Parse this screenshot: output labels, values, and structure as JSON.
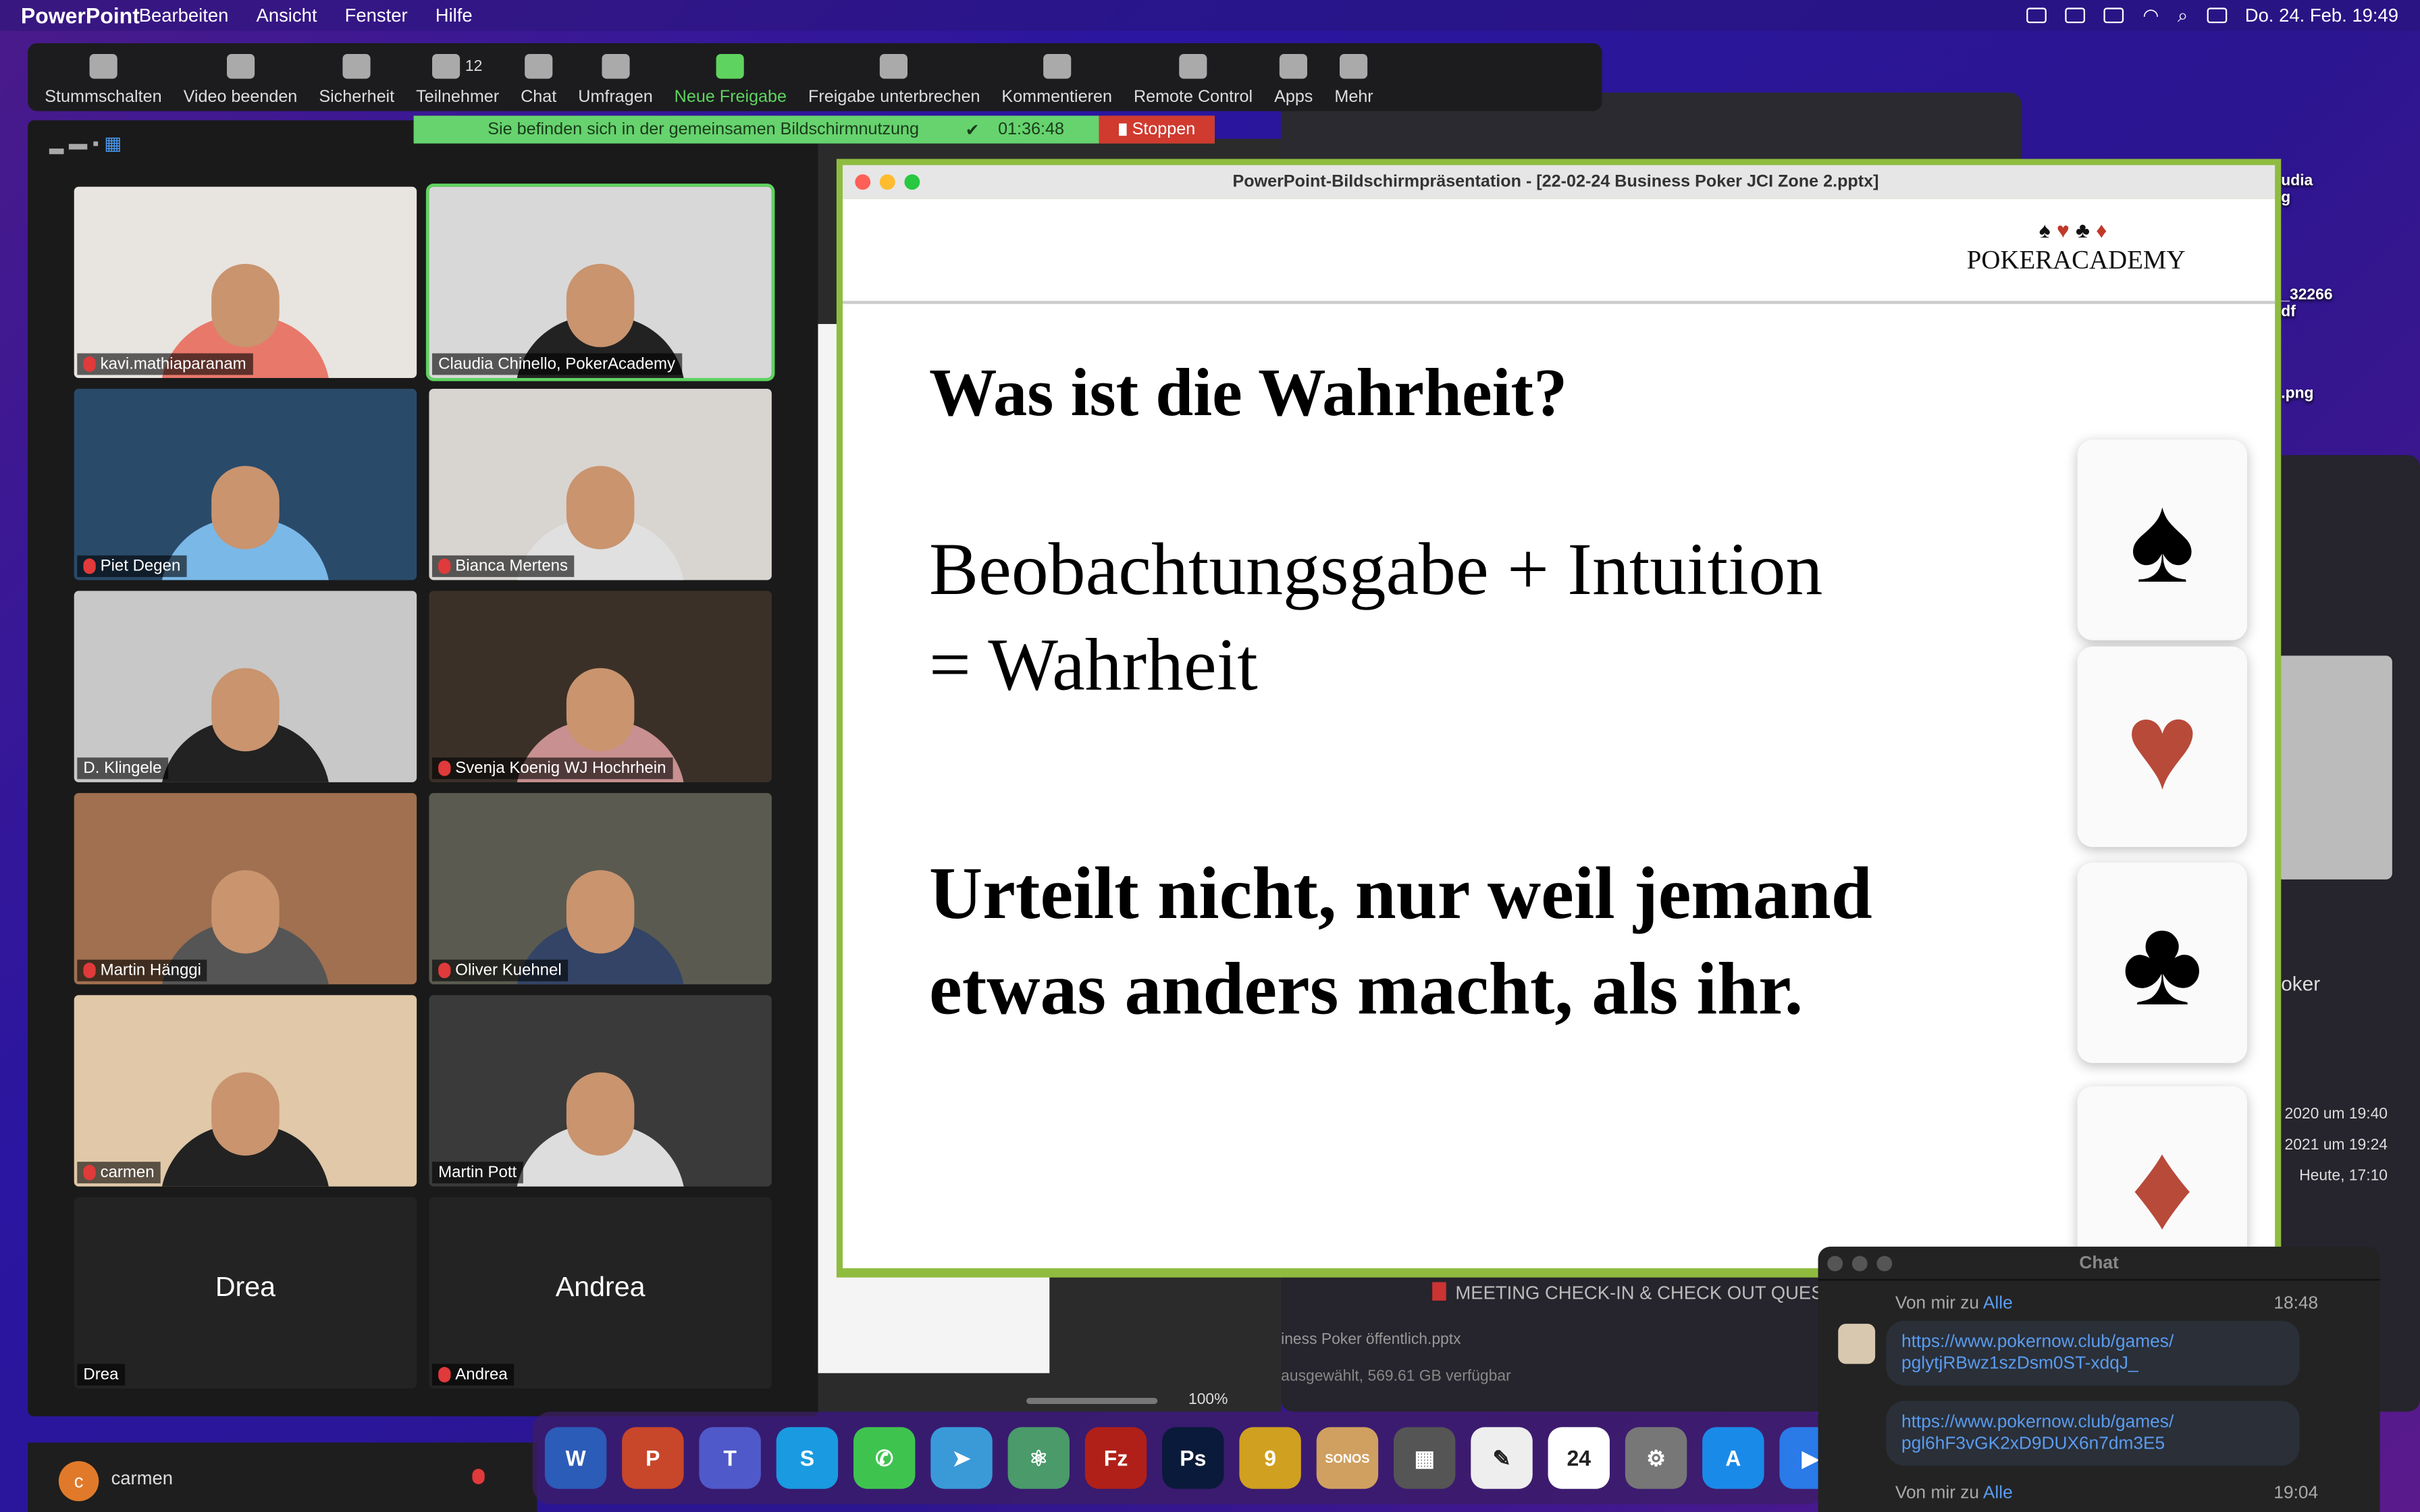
{
  "menubar": {
    "app": "PowerPoint",
    "items": [
      "Bearbeiten",
      "Ansicht",
      "Fenster",
      "Hilfe"
    ],
    "clock": "Do. 24. Feb. 19:49"
  },
  "toolbar": {
    "items": [
      {
        "label": "Stummschalten",
        "icon": "microphone-icon"
      },
      {
        "label": "Video beenden",
        "icon": "video-camera-icon"
      },
      {
        "label": "Sicherheit",
        "icon": "shield-icon"
      },
      {
        "label": "Teilnehmer",
        "icon": "participants-icon",
        "count": "12"
      },
      {
        "label": "Chat",
        "icon": "chat-bubble-icon"
      },
      {
        "label": "Umfragen",
        "icon": "poll-icon"
      },
      {
        "label": "Neue Freigabe",
        "icon": "share-screen-icon"
      },
      {
        "label": "Freigabe unterbrechen",
        "icon": "pause-icon"
      },
      {
        "label": "Kommentieren",
        "icon": "pen-icon"
      },
      {
        "label": "Remote Control",
        "icon": "mouse-icon"
      },
      {
        "label": "Apps",
        "icon": "apps-icon"
      },
      {
        "label": "Mehr",
        "icon": "more-dots-icon"
      }
    ]
  },
  "sharebar": {
    "text": "Sie befinden sich in der gemeinsamen Bildschirmnutzung",
    "timer": "01:36:48",
    "stop": "Stoppen"
  },
  "participants": [
    {
      "name": "kavi.mathiaparanam",
      "muted": true,
      "bg": "#e8e4e0",
      "shirt": "#e8786a"
    },
    {
      "name": "Claudia Chinello, PokerAcademy",
      "muted": false,
      "active": true,
      "bg": "#d8d8d8",
      "shirt": "#222"
    },
    {
      "name": "Piet Degen",
      "muted": true,
      "bg": "#2a4a6a",
      "shirt": "#7ab8e8"
    },
    {
      "name": "Bianca Mertens",
      "muted": true,
      "bg": "#d8d4d0",
      "shirt": "#e0e0e0"
    },
    {
      "name": "D. Klingele",
      "muted": false,
      "bg": "#c8c8c8",
      "shirt": "#222"
    },
    {
      "name": "Svenja Koenig WJ Hochrhein",
      "muted": true,
      "bg": "#3a3028",
      "shirt": "#c89090"
    },
    {
      "name": "Martin Hänggi",
      "muted": true,
      "bg": "#a07050",
      "shirt": "#555"
    },
    {
      "name": "Oliver Kuehnel",
      "muted": true,
      "bg": "#5a5a50",
      "shirt": "#334466"
    },
    {
      "name": "carmen",
      "muted": true,
      "bg": "#e0c8a8",
      "shirt": "#222"
    },
    {
      "name": "Martin Pott",
      "muted": false,
      "bg": "#3a3a3a",
      "shirt": "#ddd"
    },
    {
      "name": "Drea",
      "muted": false,
      "video_off": true,
      "display": "Drea"
    },
    {
      "name": "Andrea",
      "muted": true,
      "video_off": true,
      "display": "Andrea"
    }
  ],
  "presentation": {
    "window_title": "PowerPoint-Bildschirmpräsentation - [22-02-24 Business Poker JCI Zone 2.pptx]",
    "logo": "POKERACADEMY",
    "logo_suits": "♠♥♣♦",
    "heading": "Was ist die Wahrheit?",
    "line2a": "Beobachtungsgabe + Intuition",
    "line2b": "= Wahrheit",
    "line3a": "Urteilt nicht, nur weil jemand",
    "line3b": "etwas anders macht, als ihr.",
    "cards": [
      "♠",
      "♥",
      "♣",
      "♦"
    ]
  },
  "chat": {
    "title": "Chat",
    "messages": [
      {
        "from": "Von mir zu ",
        "to": "Alle",
        "time": "18:48",
        "links": [
          "https://www.pokernow.club/games/ pglytjRBwz1szDsm0ST-xdqJ_",
          "https://www.pokernow.club/games/ pgl6hF3vGK2xD9DUX6n7dm3E5"
        ]
      },
      {
        "from": "Von mir zu ",
        "to": "Alle",
        "time": "19:04"
      }
    ]
  },
  "finder": {
    "file1": "MEETING CHECK-IN & CHECK OUT QUESTI",
    "file2": "iness Poker öffentlich.pptx",
    "status": "ausgewählt, 569.61 GB verfügbar",
    "dates": [
      "2020 um 19:40",
      "2021 um 19:24",
      "Heute, 17:10"
    ],
    "label": "oker"
  },
  "desktop": {
    "files": [
      "udia\ng",
      "_32266\ndf",
      ".png"
    ]
  },
  "ppt_status": {
    "zoom": "100%"
  },
  "participant_list": {
    "name": "carmen",
    "initial": "c"
  },
  "dock": [
    {
      "name": "Word",
      "t": "W",
      "c": "#2b5cb8"
    },
    {
      "name": "PowerPoint",
      "t": "P",
      "c": "#c8462a"
    },
    {
      "name": "Teams",
      "t": "T",
      "c": "#5059c9"
    },
    {
      "name": "Skype",
      "t": "S",
      "c": "#1a9ae0"
    },
    {
      "name": "WhatsApp",
      "t": "✆",
      "c": "#3fc34f"
    },
    {
      "name": "Telegram",
      "t": "➤",
      "c": "#3a9ad8"
    },
    {
      "name": "Atom",
      "t": "⚛",
      "c": "#4a9a6a"
    },
    {
      "name": "FileZilla",
      "t": "Fz",
      "c": "#b02018"
    },
    {
      "name": "Photoshop",
      "t": "Ps",
      "c": "#0a1a3a"
    },
    {
      "name": "9",
      "t": "9",
      "c": "#d0a020"
    },
    {
      "name": "Sonos",
      "t": "SONOS",
      "c": "#d0a060"
    },
    {
      "name": "Calculator",
      "t": "▦",
      "c": "#555"
    },
    {
      "name": "TextEdit",
      "t": "✎",
      "c": "#eee"
    },
    {
      "name": "Calendar",
      "t": "24",
      "c": "#fff"
    },
    {
      "name": "System Preferences",
      "t": "⚙",
      "c": "#777"
    },
    {
      "name": "App Store",
      "t": "A",
      "c": "#1a8ae8"
    },
    {
      "name": "Zoom",
      "t": "▶",
      "c": "#2a7ae8"
    }
  ],
  "colors": {
    "share_green": "#66d36e",
    "stop_red": "#d03a2f",
    "frame_green": "#8fbc3f",
    "link_blue": "#5a9cf0",
    "heart_red": "#c0392b"
  }
}
